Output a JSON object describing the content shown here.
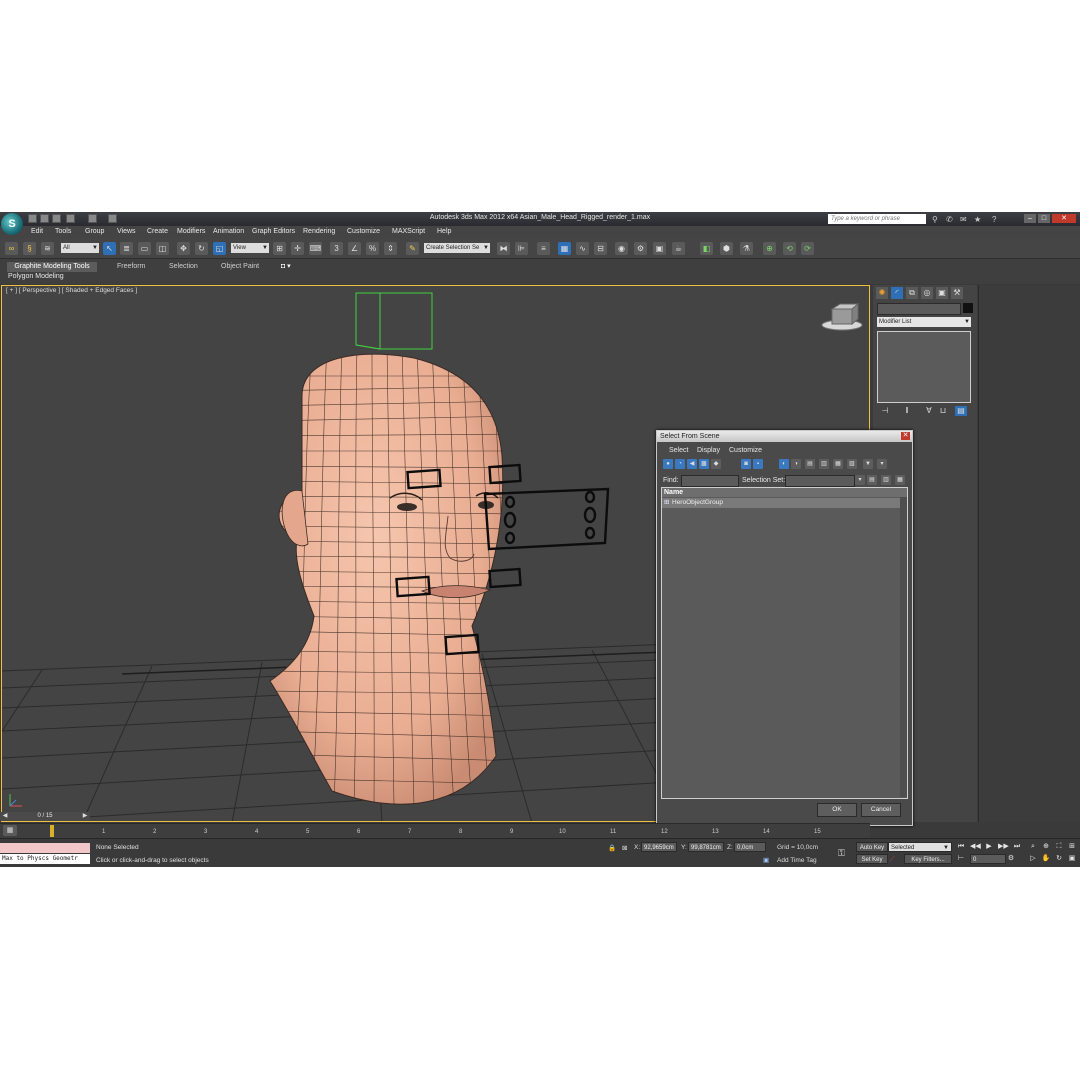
{
  "app": {
    "title": "Autodesk 3ds Max  2012 x64    Asian_Male_Head_Rigged_render_1.max",
    "search_placeholder": "Type a keyword or phrase",
    "logo_glyph": "S"
  },
  "menu": [
    "Edit",
    "Tools",
    "Group",
    "Views",
    "Create",
    "Modifiers",
    "Animation",
    "Graph Editors",
    "Rendering",
    "Customize",
    "MAXScript",
    "Help"
  ],
  "toolbar": {
    "filter_value": "All",
    "refcoord_value": "View",
    "selection_set_value": "Create Selection Se"
  },
  "ribbon": {
    "tabs": [
      "Graphite Modeling Tools",
      "Freeform",
      "Selection",
      "Object Paint"
    ],
    "sub_label": "Polygon Modeling"
  },
  "viewport": {
    "label": "[ + ] [ Perspective ] [ Shaded + Edged Faces ]"
  },
  "command_panel": {
    "modifier_list": "Modifier List"
  },
  "dialog": {
    "title": "Select From Scene",
    "menu": [
      "Select",
      "Display",
      "Customize"
    ],
    "find_label": "Find:",
    "selection_set_label": "Selection Set:",
    "column_name": "Name",
    "rows": [
      "HeroObjectGroup"
    ],
    "ok_label": "OK",
    "cancel_label": "Cancel"
  },
  "timeline": {
    "frame_display": "0 / 15",
    "ticks": [
      "1",
      "2",
      "3",
      "4",
      "5",
      "6",
      "7",
      "8",
      "9",
      "10",
      "11",
      "12",
      "13",
      "14",
      "15"
    ],
    "current_frame": 0,
    "total_frames": 15
  },
  "status": {
    "maxscript_text": "Max to Physcs Geometr",
    "selection": "None Selected",
    "prompt": "Click or click-and-drag to select objects",
    "x_label": "X:",
    "x_value": "92,9659cm",
    "y_label": "Y:",
    "y_value": "99,8781cm",
    "z_label": "Z:",
    "z_value": "0,0cm",
    "grid": "Grid = 10,0cm",
    "add_time_tag": "Add Time Tag",
    "auto_key": "Auto Key",
    "set_key": "Set Key",
    "key_mode_value": "Selected",
    "key_filters": "Key Filters...",
    "frame_value": "0"
  },
  "colors": {
    "viewport_bg": "#444444",
    "viewport_border": "#f0c040",
    "skin": "#f0b8a0",
    "helper_green": "#3fd13f",
    "selection_blue": "#2f6fb5"
  }
}
